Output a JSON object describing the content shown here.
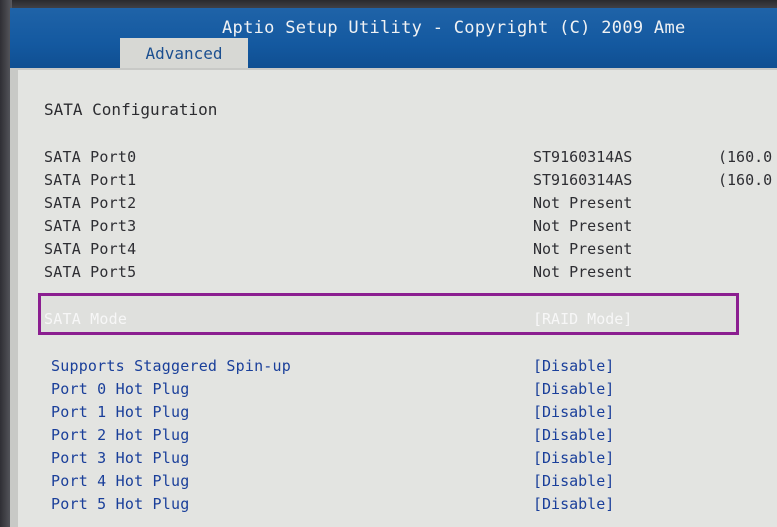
{
  "header": {
    "title": "Aptio Setup Utility - Copyright (C) 2009 Ame",
    "active_tab": "Advanced"
  },
  "page": {
    "title": "SATA Configuration"
  },
  "ports": [
    {
      "label": "SATA Port0",
      "value": "ST9160314AS",
      "capacity": "(160.0"
    },
    {
      "label": "SATA Port1",
      "value": "ST9160314AS",
      "capacity": "(160.0"
    },
    {
      "label": "SATA Port2",
      "value": "Not Present",
      "capacity": ""
    },
    {
      "label": "SATA Port3",
      "value": "Not Present",
      "capacity": ""
    },
    {
      "label": "SATA Port4",
      "value": "Not Present",
      "capacity": ""
    },
    {
      "label": "SATA Port5",
      "value": "Not Present",
      "capacity": ""
    }
  ],
  "sata_mode": {
    "label": "SATA Mode",
    "value": "[RAID Mode]"
  },
  "options": [
    {
      "label": "Supports Staggered Spin-up",
      "value": "[Disable]"
    },
    {
      "label": "Port 0 Hot Plug",
      "value": "[Disable]"
    },
    {
      "label": "Port 1 Hot Plug",
      "value": "[Disable]"
    },
    {
      "label": "Port 2 Hot Plug",
      "value": "[Disable]"
    },
    {
      "label": "Port 3 Hot Plug",
      "value": "[Disable]"
    },
    {
      "label": "Port 4 Hot Plug",
      "value": "[Disable]"
    },
    {
      "label": "Port 5 Hot Plug",
      "value": "[Disable]"
    }
  ],
  "colors": {
    "title_bar": "#1459a0",
    "highlight_border": "#8b1e90",
    "option_text": "#1a3f9a"
  }
}
